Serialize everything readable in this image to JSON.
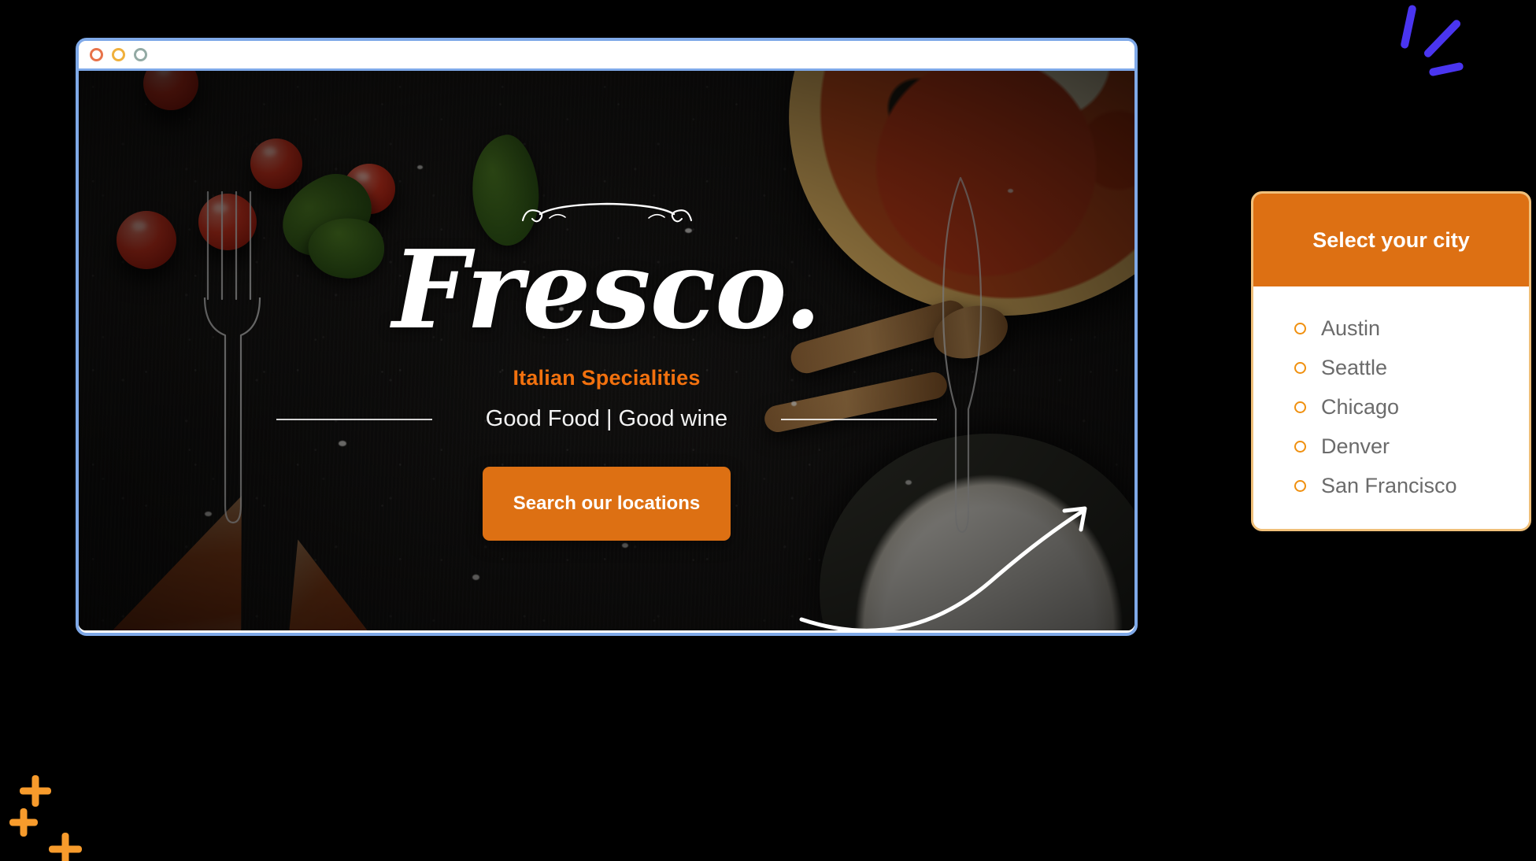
{
  "window": {
    "dots": [
      {
        "name": "close-dot",
        "color": "#e8734a"
      },
      {
        "name": "minimize-dot",
        "color": "#f0b03c"
      },
      {
        "name": "maximize-dot",
        "color": "#93aaa4"
      }
    ]
  },
  "hero": {
    "brand_title": "Fresco.",
    "brand_subtitle": "Italian Specialities",
    "tagline": "Good Food | Good wine",
    "cta_label": "Search our locations"
  },
  "dropdown": {
    "title": "Select your city",
    "cities": [
      {
        "label": "Austin"
      },
      {
        "label": "Seattle"
      },
      {
        "label": "Chicago"
      },
      {
        "label": "Denver"
      },
      {
        "label": "San Francisco"
      }
    ]
  },
  "colors": {
    "brand_orange": "#dd7013",
    "accent_orange": "#f2710e",
    "radio_orange": "#f0900f",
    "card_border": "#f0c07a",
    "window_border": "#7fa9e8",
    "deco_purple": "#4a35f0",
    "deco_orange": "#f79b2c",
    "page_background": "#000000"
  }
}
